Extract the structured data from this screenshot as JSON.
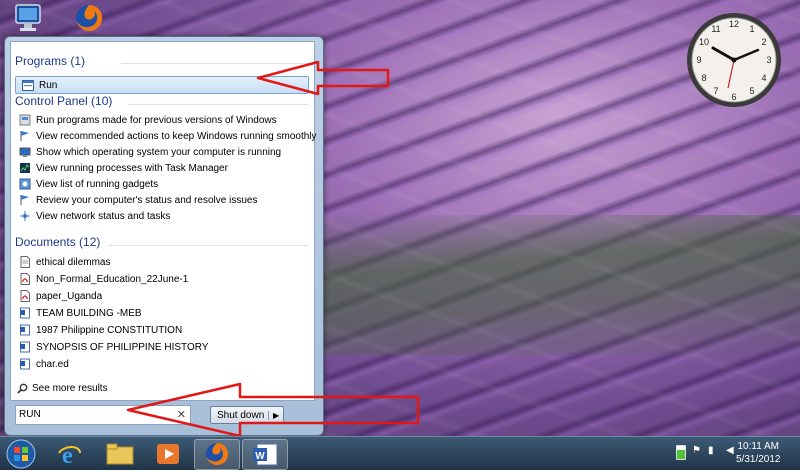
{
  "desktop": {
    "icons": [
      "computer-icon",
      "firefox-icon"
    ]
  },
  "start_menu": {
    "programs": {
      "heading": "Programs (1)",
      "items": [
        {
          "label": "Run",
          "icon": "run-icon"
        }
      ]
    },
    "control_panel": {
      "heading": "Control Panel (10)",
      "items": [
        {
          "label": "Run programs made for previous versions of Windows",
          "icon": "compat-icon"
        },
        {
          "label": "View recommended actions to keep Windows running smoothly",
          "icon": "flag-icon"
        },
        {
          "label": "Show which operating system your computer is running",
          "icon": "system-icon"
        },
        {
          "label": "View running processes with Task Manager",
          "icon": "taskmanager-icon"
        },
        {
          "label": "View list of running gadgets",
          "icon": "gadgets-icon"
        },
        {
          "label": "Review your computer's status and resolve issues",
          "icon": "flag-icon"
        },
        {
          "label": "View network status and tasks",
          "icon": "network-icon"
        }
      ]
    },
    "documents": {
      "heading": "Documents (12)",
      "items": [
        {
          "label": "ethical dilemmas",
          "icon": "document-icon"
        },
        {
          "label": "Non_Formal_Education_22June-1",
          "icon": "pdf-icon"
        },
        {
          "label": "paper_Uganda",
          "icon": "pdf-icon"
        },
        {
          "label": "TEAM BUILDING -MEB",
          "icon": "word-document-icon"
        },
        {
          "label": "1987 Philippine CONSTITUTION",
          "icon": "word-document-icon"
        },
        {
          "label": "SYNOPSIS OF PHILIPPINE HISTORY",
          "icon": "word-document-icon"
        },
        {
          "label": "char.ed",
          "icon": "word-document-icon"
        }
      ]
    },
    "see_more": "See more results",
    "search": {
      "value": "RUN"
    },
    "shutdown_label": "Shut down"
  },
  "taskbar": {
    "buttons": [
      "start-orb",
      "internet-explorer-icon",
      "explorer-folder-icon",
      "media-player-icon",
      "firefox-icon",
      "word-icon"
    ],
    "time": "10:11 AM",
    "date": "5/31/2012"
  },
  "clock_gadget": {
    "hour": 10,
    "minute": 11
  },
  "colors": {
    "heading": "#1e3a8a",
    "annotation_arrow": "#e01818"
  }
}
